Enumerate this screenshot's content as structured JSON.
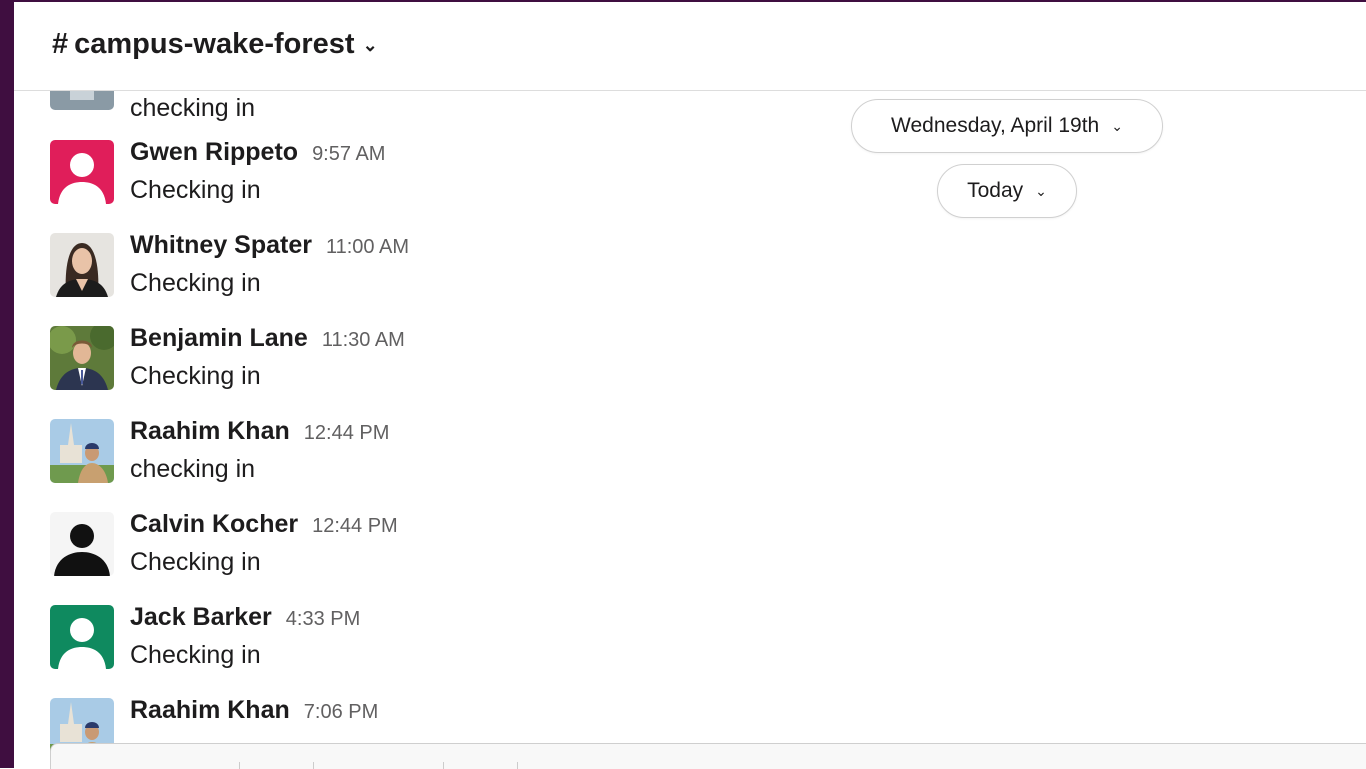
{
  "channel": {
    "hash": "#",
    "name": "campus-wake-forest"
  },
  "partial_top_message": {
    "text": "checking in"
  },
  "messages": [
    {
      "author": "Gwen Rippeto",
      "time": "9:57 AM",
      "text": "Checking in",
      "avatar": "default-avatar-pink"
    },
    {
      "author": "Whitney Spater",
      "time": "11:00 AM",
      "text": "Checking in",
      "avatar": "photo-avatar"
    },
    {
      "author": "Benjamin Lane",
      "time": "11:30 AM",
      "text": "Checking in",
      "avatar": "photo-avatar"
    },
    {
      "author": "Raahim Khan",
      "time": "12:44 PM",
      "text": "checking in",
      "avatar": "photo-avatar"
    },
    {
      "author": "Calvin Kocher",
      "time": "12:44 PM",
      "text": "Checking in",
      "avatar": "default-avatar-black"
    },
    {
      "author": "Jack Barker",
      "time": "4:33 PM",
      "text": "Checking in",
      "avatar": "default-avatar-green"
    },
    {
      "author": "Raahim Khan",
      "time": "7:06 PM",
      "text": "",
      "avatar": "photo-avatar"
    }
  ],
  "date_dividers": {
    "first": "Wednesday, April 19th",
    "second": "Today"
  },
  "colors": {
    "sidebar": "#3f0e40",
    "avatar_pink": "#e01e5a",
    "avatar_green": "#0f8a5f"
  }
}
